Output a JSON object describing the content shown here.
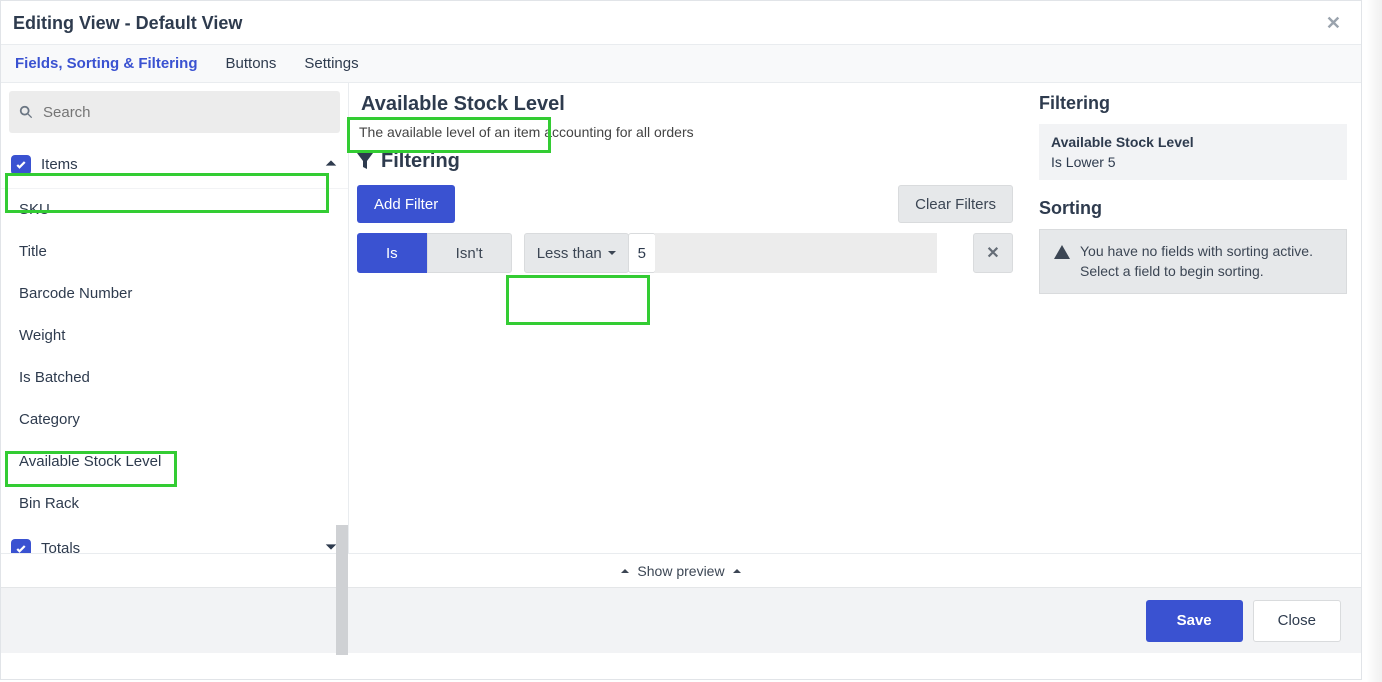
{
  "header": {
    "title": "Editing View - Default View"
  },
  "tabs": [
    "Fields, Sorting & Filtering",
    "Buttons",
    "Settings"
  ],
  "active_tab": 0,
  "search": {
    "placeholder": "Search"
  },
  "groups": [
    {
      "name": "Items",
      "expanded": true,
      "checked": true,
      "children": [
        "SKU",
        "Title",
        "Barcode Number",
        "Weight",
        "Is Batched",
        "Category",
        "Available Stock Level",
        "Bin Rack"
      ]
    },
    {
      "name": "Totals",
      "expanded": false,
      "checked": true,
      "children": []
    }
  ],
  "middle": {
    "title": "Available Stock Level",
    "description": "The available level of an item accounting for all orders",
    "filtering_label": "Filtering",
    "add_filter_label": "Add Filter",
    "clear_filters_label": "Clear Filters",
    "filter_row": {
      "is_label": "Is",
      "isnt_label": "Isn't",
      "is_active": "Is",
      "comparator": "Less than",
      "value": "5"
    }
  },
  "right": {
    "filtering_label": "Filtering",
    "filter_summary_title": "Available Stock Level",
    "filter_summary_text": "Is Lower 5",
    "sorting_label": "Sorting",
    "sorting_alert": "You have no fields with sorting active. Select a field to begin sorting."
  },
  "preview_label": "Show preview",
  "footer": {
    "save": "Save",
    "close": "Close"
  }
}
